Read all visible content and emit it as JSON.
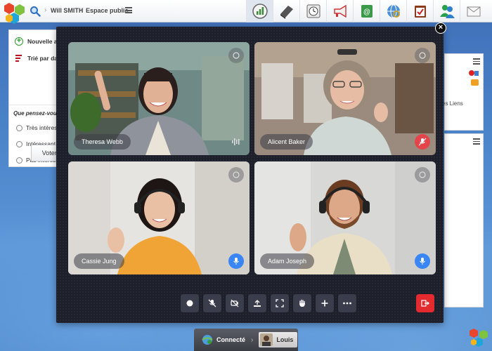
{
  "topbar": {
    "user_name": "Will SMITH",
    "space_label": "Espace public",
    "apps": [
      "stats-icon",
      "notebook-icon",
      "clock-icon",
      "megaphone-icon",
      "contacts-icon",
      "links-icon",
      "tasks-icon",
      "messenger-icon",
      "mail-icon"
    ]
  },
  "left_panel": {
    "new_label": "Nouvelle ac",
    "sort_label": "Trié par dat",
    "question": "Que pensez-vous",
    "options": [
      "Très intéress",
      "Intéressant",
      "Pas intéress"
    ],
    "vote_label": "Voter e"
  },
  "right_panel": {
    "links_label": "es Liens"
  },
  "call": {
    "participants": [
      {
        "name": "Theresa Webb",
        "mic": "speaking"
      },
      {
        "name": "Alicent Baker",
        "mic": "muted"
      },
      {
        "name": "Cassie Jung",
        "mic": "on"
      },
      {
        "name": "Adam Joseph",
        "mic": "on"
      }
    ],
    "controls": [
      "record-icon",
      "mute-mic-icon",
      "camera-off-icon",
      "share-screen-icon",
      "fullscreen-icon",
      "raise-hand-icon",
      "add-icon",
      "more-icon"
    ],
    "leave_icon": "leave-call-icon",
    "colors": {
      "background": "#1d1f2b",
      "control": "#3a3d4c",
      "leave": "#e32a2f",
      "mic_active": "#3a86f5",
      "mic_muted": "#e4454b"
    }
  },
  "status": {
    "connection": "Connecté",
    "user": "Louis"
  }
}
